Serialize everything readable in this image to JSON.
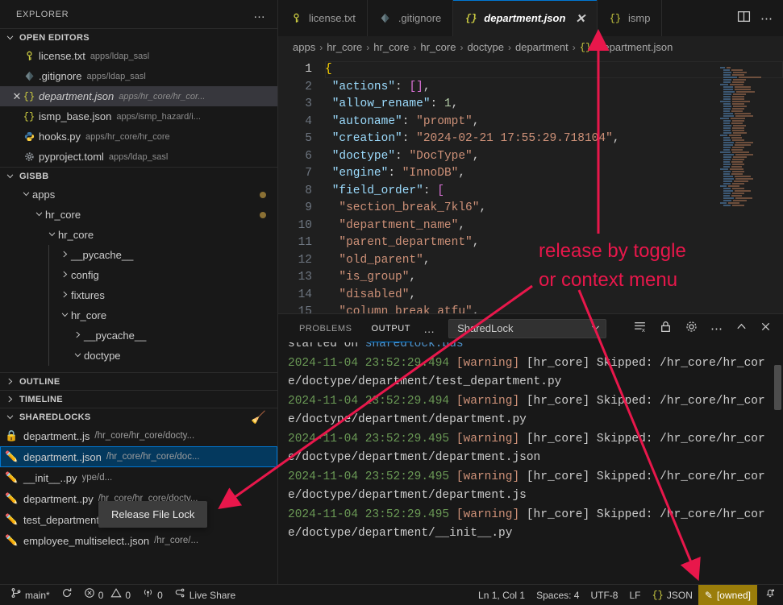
{
  "explorer": {
    "title": "EXPLORER",
    "more_label": "…",
    "open_editors": {
      "label": "OPEN EDITORS",
      "items": [
        {
          "name": "license.txt",
          "desc": "apps/ldap_sasl",
          "icon": "key-icon",
          "active": false
        },
        {
          "name": ".gitignore",
          "desc": "apps/ldap_sasl",
          "icon": "git-icon",
          "active": false
        },
        {
          "name": "department.json",
          "desc": "apps/hr_core/hr_cor...",
          "icon": "json-icon",
          "active": true
        },
        {
          "name": "ismp_base.json",
          "desc": "apps/ismp_hazard/i...",
          "icon": "json-icon",
          "active": false
        },
        {
          "name": "hooks.py",
          "desc": "apps/hr_core/hr_core",
          "icon": "python-icon",
          "active": false
        },
        {
          "name": "pyproject.toml",
          "desc": "apps/ldap_sasl",
          "icon": "gear-icon",
          "active": false
        }
      ]
    },
    "workspace": {
      "label": "GISBB",
      "tree": [
        {
          "label": "apps",
          "depth": 1,
          "expanded": true,
          "badge": true
        },
        {
          "label": "hr_core",
          "depth": 2,
          "expanded": true,
          "badge": true
        },
        {
          "label": "hr_core",
          "depth": 3,
          "expanded": true,
          "badge": false
        },
        {
          "label": "__pycache__",
          "depth": 4,
          "expanded": false,
          "badge": false
        },
        {
          "label": "config",
          "depth": 4,
          "expanded": false,
          "badge": false
        },
        {
          "label": "fixtures",
          "depth": 4,
          "expanded": false,
          "badge": false
        },
        {
          "label": "hr_core",
          "depth": 4,
          "expanded": true,
          "badge": false
        },
        {
          "label": "__pycache__",
          "depth": 5,
          "expanded": false,
          "badge": false
        },
        {
          "label": "doctype",
          "depth": 5,
          "expanded": true,
          "badge": false
        }
      ]
    },
    "outline_label": "OUTLINE",
    "timeline_label": "TIMELINE",
    "sharedlocks": {
      "label": "SHAREDLOCKS",
      "clear_icon": "broom-icon",
      "items": [
        {
          "name": "department..js",
          "path": "/hr_core/hr_core/docty...",
          "icon": "lock-icon",
          "selected": false
        },
        {
          "name": "department..json",
          "path": "/hr_core/hr_core/doc...",
          "icon": "pencil-icon",
          "selected": true
        },
        {
          "name": "__init__..py",
          "path": "ype/d...",
          "icon": "pencil-icon",
          "selected": false
        },
        {
          "name": "department..py",
          "path": "/hr_core/hr_core/docty...",
          "icon": "pencil-icon",
          "selected": false
        },
        {
          "name": "test_department..py",
          "path": "/hr_core/hr_core/...",
          "icon": "pencil-icon",
          "selected": false
        },
        {
          "name": "employee_multiselect..json",
          "path": "/hr_core/...",
          "icon": "pencil-icon",
          "selected": false
        }
      ],
      "tooltip": "Release File Lock"
    }
  },
  "editor": {
    "tabs": [
      {
        "label": "license.txt",
        "icon": "key-icon",
        "active": false,
        "closable": false
      },
      {
        "label": ".gitignore",
        "icon": "git-icon",
        "active": false,
        "closable": false
      },
      {
        "label": "department.json",
        "icon": "json-icon",
        "active": true,
        "closable": true
      },
      {
        "label": "ismp",
        "icon": "json-icon",
        "active": false,
        "closable": false
      }
    ],
    "close_glyph": "✕",
    "split_icon": "split-editor-icon",
    "more_icon": "more-actions-icon",
    "breadcrumb": [
      "apps",
      "hr_core",
      "hr_core",
      "hr_core",
      "doctype",
      "department",
      "department.json"
    ],
    "breadcrumb_file_icon": "json-icon",
    "lines": [
      {
        "no": 1,
        "tokens": [
          {
            "t": "{",
            "c": "br"
          }
        ]
      },
      {
        "no": 2,
        "tokens": [
          {
            "t": " ",
            "c": "p"
          },
          {
            "t": "\"actions\"",
            "c": "k"
          },
          {
            "t": ": ",
            "c": "p"
          },
          {
            "t": "[]",
            "c": "brp"
          },
          {
            "t": ",",
            "c": "p"
          }
        ]
      },
      {
        "no": 3,
        "tokens": [
          {
            "t": " ",
            "c": "p"
          },
          {
            "t": "\"allow_rename\"",
            "c": "k"
          },
          {
            "t": ": ",
            "c": "p"
          },
          {
            "t": "1",
            "c": "n"
          },
          {
            "t": ",",
            "c": "p"
          }
        ]
      },
      {
        "no": 4,
        "tokens": [
          {
            "t": " ",
            "c": "p"
          },
          {
            "t": "\"autoname\"",
            "c": "k"
          },
          {
            "t": ": ",
            "c": "p"
          },
          {
            "t": "\"prompt\"",
            "c": "s"
          },
          {
            "t": ",",
            "c": "p"
          }
        ]
      },
      {
        "no": 5,
        "tokens": [
          {
            "t": " ",
            "c": "p"
          },
          {
            "t": "\"creation\"",
            "c": "k"
          },
          {
            "t": ": ",
            "c": "p"
          },
          {
            "t": "\"2024-02-21 17:55:29.718104\"",
            "c": "s"
          },
          {
            "t": ",",
            "c": "p"
          }
        ]
      },
      {
        "no": 6,
        "tokens": [
          {
            "t": " ",
            "c": "p"
          },
          {
            "t": "\"doctype\"",
            "c": "k"
          },
          {
            "t": ": ",
            "c": "p"
          },
          {
            "t": "\"DocType\"",
            "c": "s"
          },
          {
            "t": ",",
            "c": "p"
          }
        ]
      },
      {
        "no": 7,
        "tokens": [
          {
            "t": " ",
            "c": "p"
          },
          {
            "t": "\"engine\"",
            "c": "k"
          },
          {
            "t": ": ",
            "c": "p"
          },
          {
            "t": "\"InnoDB\"",
            "c": "s"
          },
          {
            "t": ",",
            "c": "p"
          }
        ]
      },
      {
        "no": 8,
        "tokens": [
          {
            "t": " ",
            "c": "p"
          },
          {
            "t": "\"field_order\"",
            "c": "k"
          },
          {
            "t": ": ",
            "c": "p"
          },
          {
            "t": "[",
            "c": "brp"
          }
        ]
      },
      {
        "no": 9,
        "tokens": [
          {
            "t": "  ",
            "c": "p"
          },
          {
            "t": "\"section_break_7kl6\"",
            "c": "s"
          },
          {
            "t": ",",
            "c": "p"
          }
        ]
      },
      {
        "no": 10,
        "tokens": [
          {
            "t": "  ",
            "c": "p"
          },
          {
            "t": "\"department_name\"",
            "c": "s"
          },
          {
            "t": ",",
            "c": "p"
          }
        ]
      },
      {
        "no": 11,
        "tokens": [
          {
            "t": "  ",
            "c": "p"
          },
          {
            "t": "\"parent_department\"",
            "c": "s"
          },
          {
            "t": ",",
            "c": "p"
          }
        ]
      },
      {
        "no": 12,
        "tokens": [
          {
            "t": "  ",
            "c": "p"
          },
          {
            "t": "\"old_parent\"",
            "c": "s"
          },
          {
            "t": ",",
            "c": "p"
          }
        ]
      },
      {
        "no": 13,
        "tokens": [
          {
            "t": "  ",
            "c": "p"
          },
          {
            "t": "\"is_group\"",
            "c": "s"
          },
          {
            "t": ",",
            "c": "p"
          }
        ]
      },
      {
        "no": 14,
        "tokens": [
          {
            "t": "  ",
            "c": "p"
          },
          {
            "t": "\"disabled\"",
            "c": "s"
          },
          {
            "t": ",",
            "c": "p"
          }
        ]
      },
      {
        "no": 15,
        "tokens": [
          {
            "t": "  ",
            "c": "p"
          },
          {
            "t": "\"column_break_atfu\"",
            "c": "s"
          },
          {
            "t": ",",
            "c": "p"
          }
        ]
      }
    ]
  },
  "panel": {
    "tabs": [
      {
        "label": "PROBLEMS",
        "active": false
      },
      {
        "label": "OUTPUT",
        "active": true
      }
    ],
    "more_label": "…",
    "channel_selected": "SharedLock",
    "channel_chevron": "chevron-down-icon",
    "tools": [
      "clear-output-icon",
      "lock-icon",
      "gear-icon",
      "more-actions-icon",
      "chevron-up-icon",
      "close-icon"
    ],
    "output_lines": [
      {
        "segments": [
          {
            "t": "started on ",
            "c": "plain"
          },
          {
            "t": "sharedlock.bus",
            "c": "o-blue"
          }
        ]
      },
      {
        "segments": [
          {
            "t": "2024-11-04 23:52:29.494 ",
            "c": "o-date"
          },
          {
            "t": "[warning] ",
            "c": "o-warn"
          },
          {
            "t": "[hr_core] Skipped: /hr_core/hr_core/doctype/department/test_department.py",
            "c": "plain"
          }
        ]
      },
      {
        "segments": [
          {
            "t": "2024-11-04 23:52:29.494 ",
            "c": "o-date"
          },
          {
            "t": "[warning] ",
            "c": "o-warn"
          },
          {
            "t": "[hr_core] Skipped: /hr_core/hr_core/doctype/department/department.py",
            "c": "plain"
          }
        ]
      },
      {
        "segments": [
          {
            "t": "2024-11-04 23:52:29.495 ",
            "c": "o-date"
          },
          {
            "t": "[warning] ",
            "c": "o-warn"
          },
          {
            "t": "[hr_core] Skipped: /hr_core/hr_core/doctype/department/department.json",
            "c": "plain"
          }
        ]
      },
      {
        "segments": [
          {
            "t": "2024-11-04 23:52:29.495 ",
            "c": "o-date"
          },
          {
            "t": "[warning] ",
            "c": "o-warn"
          },
          {
            "t": "[hr_core] Skipped: /hr_core/hr_core/doctype/department/department.js",
            "c": "plain"
          }
        ]
      },
      {
        "segments": [
          {
            "t": "2024-11-04 23:52:29.495 ",
            "c": "o-date"
          },
          {
            "t": "[warning] ",
            "c": "o-warn"
          },
          {
            "t": "[hr_core] Skipped: /hr_core/hr_core/doctype/department/__init__.py",
            "c": "plain"
          }
        ]
      }
    ]
  },
  "statusbar": {
    "branch": "main*",
    "sync_icon": "sync-icon",
    "errors": "0",
    "warnings": "0",
    "ports": "0",
    "live_share": "Live Share",
    "position": "Ln 1, Col 1",
    "indent": "Spaces: 4",
    "encoding": "UTF-8",
    "eol": "LF",
    "language": "JSON",
    "language_icon": "json-icon",
    "lock_state": "[owned]",
    "lock_state_icon": "pencil-icon",
    "lock_state_color": "#9a7d0a",
    "bell_icon": "bell-icon"
  },
  "annotations": {
    "color": "#e8174b",
    "text_line1": "release by toggle",
    "text_line2": "or context menu"
  }
}
